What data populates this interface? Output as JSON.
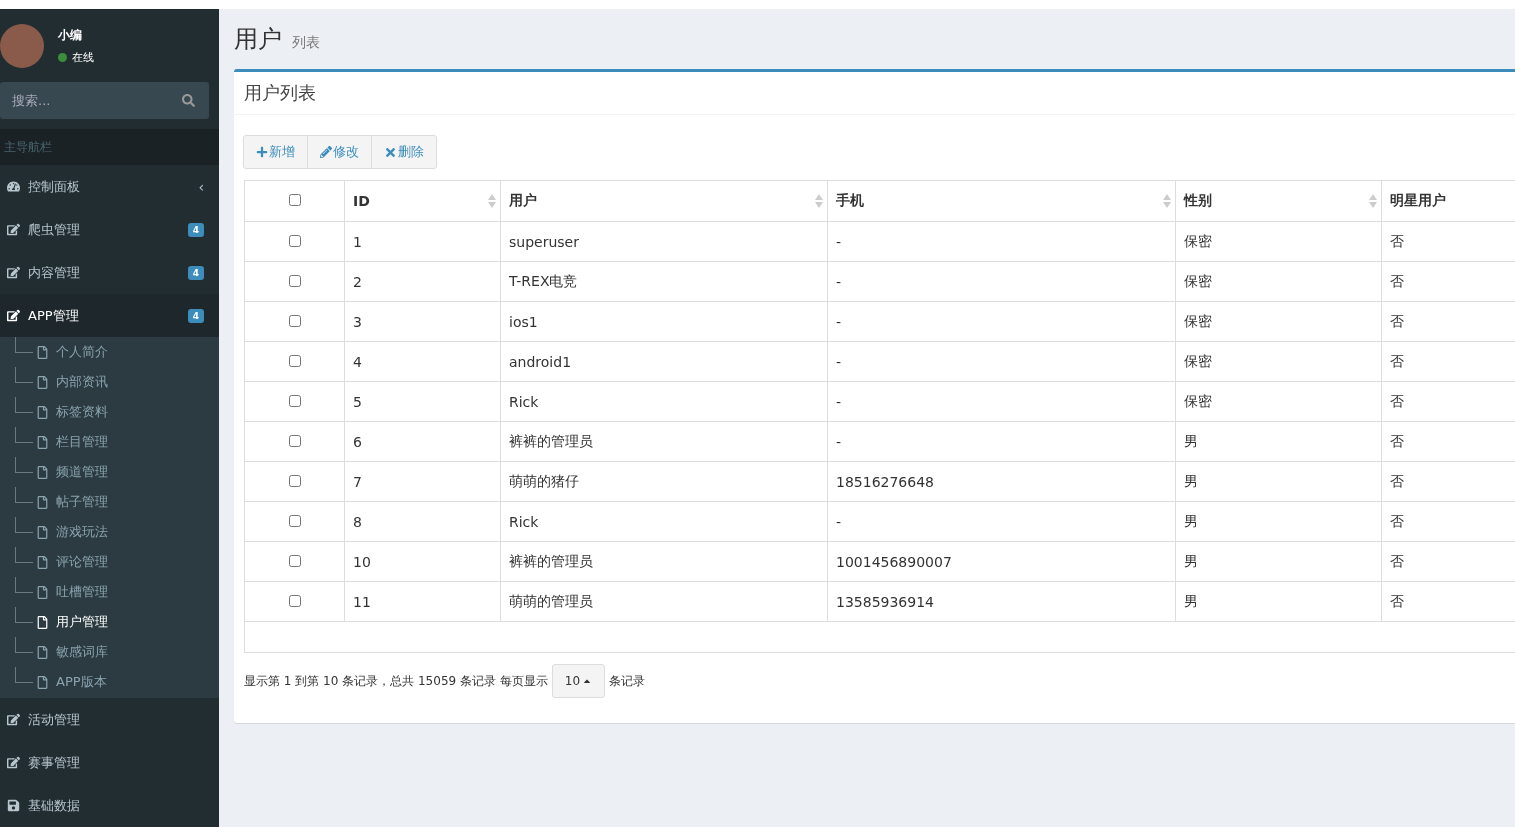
{
  "user_panel": {
    "name": "小编",
    "status": "在线"
  },
  "sidebar": {
    "search": {
      "placeholder": "搜索..."
    },
    "header": "主导航栏",
    "items": [
      {
        "label": "控制面板",
        "kind": "dashboard",
        "expanded": false,
        "chevron": "‹"
      },
      {
        "label": "爬虫管理",
        "kind": "edit",
        "badge": "4"
      },
      {
        "label": "内容管理",
        "kind": "edit",
        "badge": "4"
      },
      {
        "label": "APP管理",
        "kind": "edit",
        "badge": "4",
        "expanded": true,
        "children": [
          {
            "label": "个人简介",
            "selected": false
          },
          {
            "label": "内部资讯",
            "selected": false
          },
          {
            "label": "标签资料",
            "selected": false
          },
          {
            "label": "栏目管理",
            "selected": false
          },
          {
            "label": "频道管理",
            "selected": false
          },
          {
            "label": "帖子管理",
            "selected": false
          },
          {
            "label": "游戏玩法",
            "selected": false
          },
          {
            "label": "评论管理",
            "selected": false
          },
          {
            "label": "吐槽管理",
            "selected": false
          },
          {
            "label": "用户管理",
            "selected": true
          },
          {
            "label": "敏感词库",
            "selected": false
          },
          {
            "label": "APP版本",
            "selected": false
          }
        ]
      },
      {
        "label": "活动管理",
        "kind": "edit"
      },
      {
        "label": "赛事管理",
        "kind": "edit"
      },
      {
        "label": "基础数据",
        "kind": "disk"
      }
    ]
  },
  "page_header": {
    "title": "用户",
    "subtitle": "列表"
  },
  "box": {
    "title": "用户列表",
    "toolbar": [
      {
        "label": "新增",
        "kind": "add"
      },
      {
        "label": "修改",
        "kind": "edit"
      },
      {
        "label": "删除",
        "kind": "delete"
      }
    ],
    "table": {
      "header_checked": false,
      "columns": [
        {
          "label": "ID",
          "sortable": true
        },
        {
          "label": "用户",
          "sortable": true
        },
        {
          "label": "手机",
          "sortable": true
        },
        {
          "label": "性别",
          "sortable": true
        },
        {
          "label": "明星用户"
        }
      ],
      "rows": [
        {
          "checked": false,
          "cells": [
            "1",
            "superuser",
            "-",
            "保密",
            "否"
          ]
        },
        {
          "checked": false,
          "cells": [
            "2",
            "T-REX电竞",
            "-",
            "保密",
            "否"
          ]
        },
        {
          "checked": false,
          "cells": [
            "3",
            "ios1",
            "-",
            "保密",
            "否"
          ]
        },
        {
          "checked": false,
          "cells": [
            "4",
            "android1",
            "-",
            "保密",
            "否"
          ]
        },
        {
          "checked": false,
          "cells": [
            "5",
            "Rick",
            "-",
            "保密",
            "否"
          ]
        },
        {
          "checked": false,
          "cells": [
            "6",
            "裤裤的管理员",
            "-",
            "男",
            "否"
          ]
        },
        {
          "checked": false,
          "cells": [
            "7",
            "萌萌的猪仔",
            "18516276648",
            "男",
            "否"
          ]
        },
        {
          "checked": false,
          "cells": [
            "8",
            "Rick",
            "-",
            "男",
            "否"
          ]
        },
        {
          "checked": false,
          "cells": [
            "10",
            "裤裤的管理员",
            "1001456890007",
            "男",
            "否"
          ]
        },
        {
          "checked": false,
          "cells": [
            "11",
            "萌萌的管理员",
            "13585936914",
            "男",
            "否"
          ]
        }
      ]
    },
    "pagination": {
      "info": "显示第 1 到第 10 条记录，总共 15059 条记录 每页显示",
      "page_size": "10",
      "suffix": "条记录"
    }
  }
}
